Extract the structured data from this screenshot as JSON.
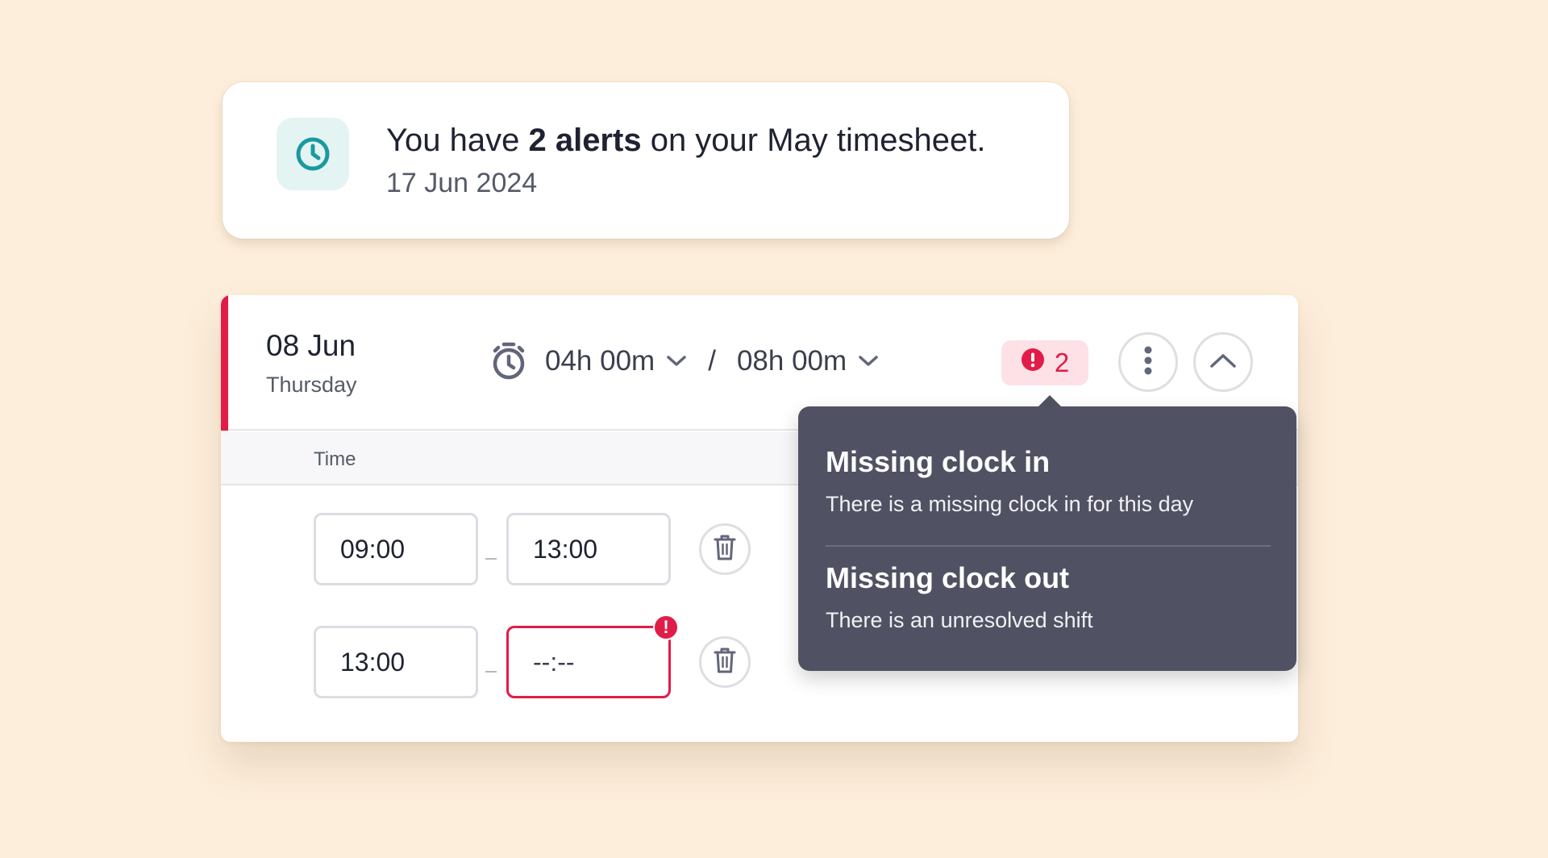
{
  "notification": {
    "icon": "clock-icon",
    "message_prefix": "You have ",
    "message_bold": "2 alerts",
    "message_suffix": " on your May timesheet.",
    "date": "17 Jun 2024",
    "accent_color": "#1a9aa0"
  },
  "day": {
    "date": "08 Jun",
    "weekday": "Thursday",
    "worked": "04h 00m",
    "separator": "/",
    "planned": "08h 00m",
    "alert_count": "2",
    "alert_color": "#e21c48",
    "column_time": "Time",
    "shifts": [
      {
        "start": "09:00",
        "end": "13:00",
        "end_error": false
      },
      {
        "start": "13:00",
        "end": "--:--",
        "end_error": true
      }
    ]
  },
  "tooltip": {
    "alerts": [
      {
        "title": "Missing clock in",
        "description": "There is a missing clock in for this day"
      },
      {
        "title": "Missing clock out",
        "description": "There is an unresolved shift"
      }
    ]
  }
}
